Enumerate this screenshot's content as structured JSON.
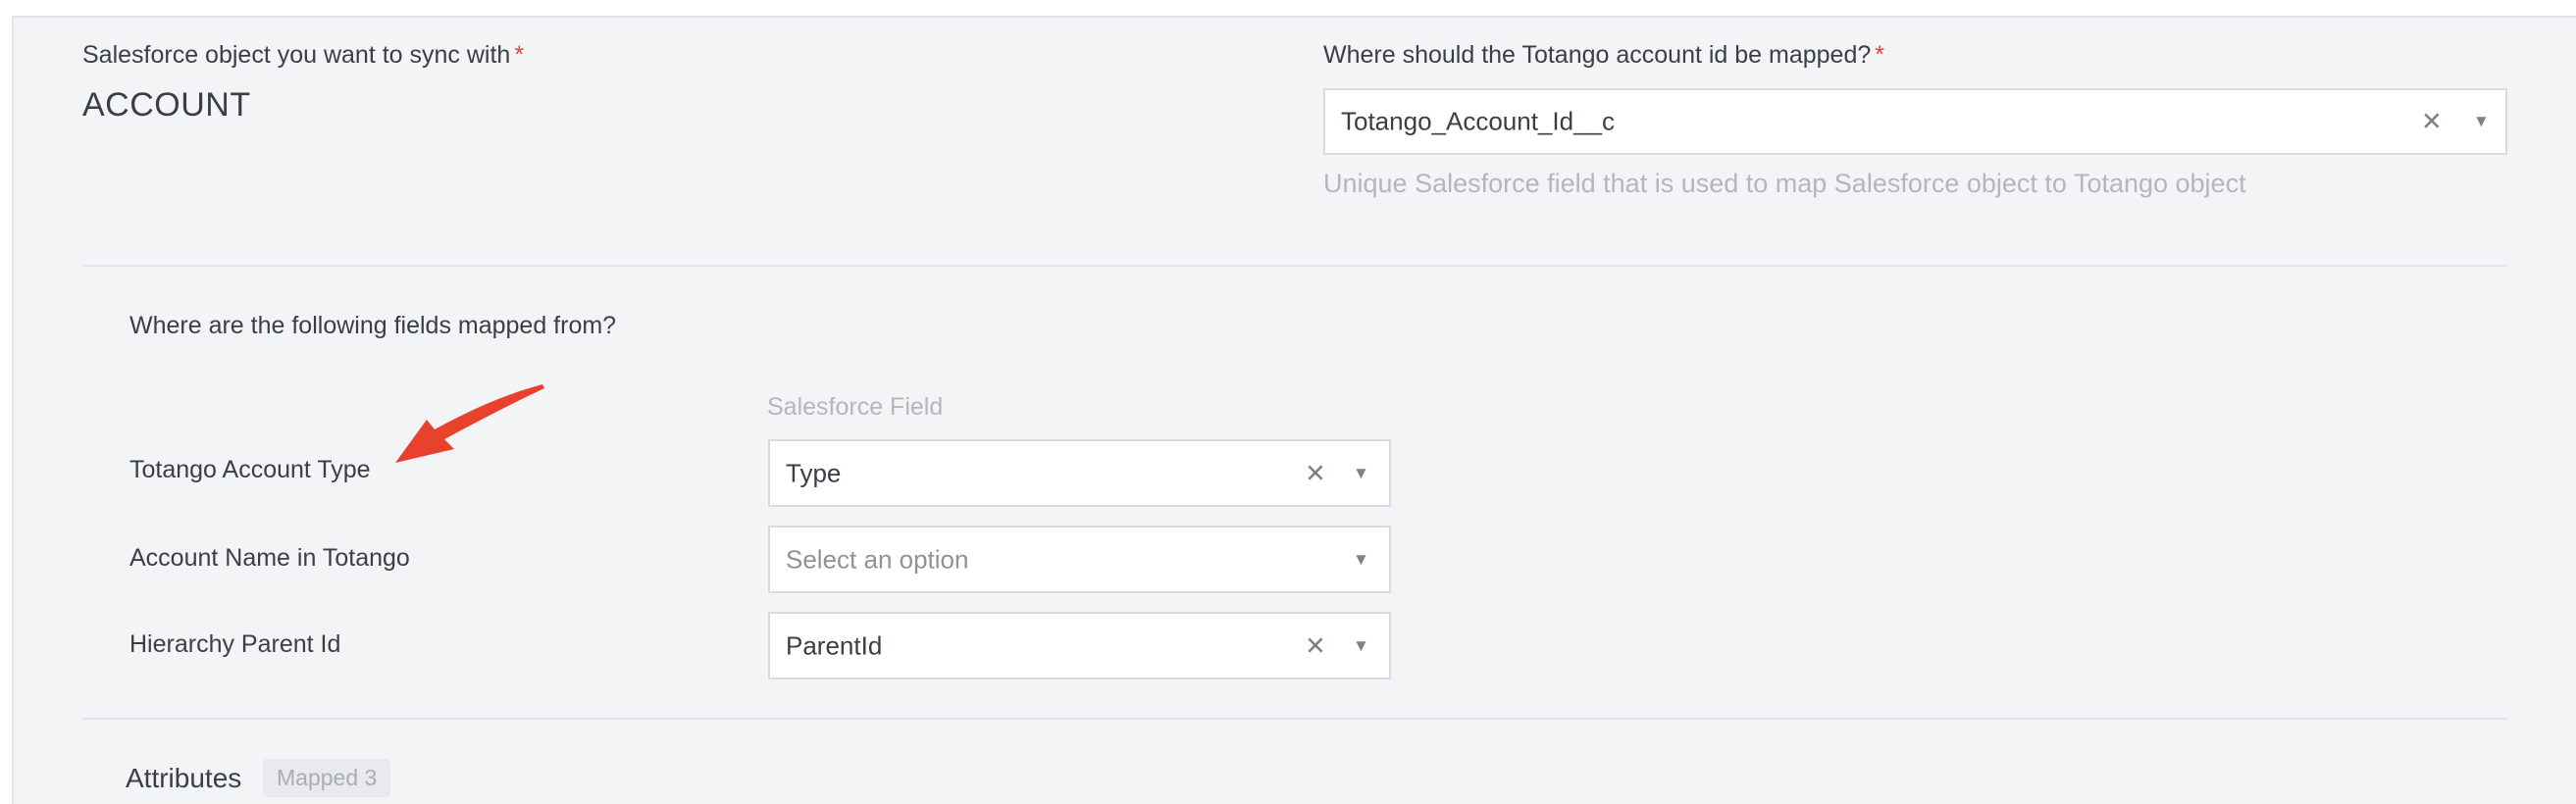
{
  "sync": {
    "object_label": "Salesforce object you want to sync with",
    "required_mark": "*",
    "object_value": "ACCOUNT"
  },
  "mapping": {
    "id_label": "Where should the Totango account id be mapped?",
    "required_mark": "*",
    "id_value": "Totango_Account_Id__c",
    "id_hint": "Unique Salesforce field that is used to map Salesforce object to Totango object"
  },
  "fields": {
    "heading": "Where are the following fields mapped from?",
    "column_header": "Salesforce Field",
    "rows": [
      {
        "label": "Totango Account Type",
        "value": "Type",
        "placeholder": ""
      },
      {
        "label": "Account Name in Totango",
        "value": "",
        "placeholder": "Select an option"
      },
      {
        "label": "Hierarchy Parent Id",
        "value": "ParentId",
        "placeholder": ""
      }
    ]
  },
  "attributes": {
    "title": "Attributes",
    "badge": "Mapped 3"
  },
  "icons": {
    "clear": "clear-x-icon",
    "caret": "caret-down-icon",
    "annotation": "red-arrow-annotation"
  },
  "colors": {
    "background": "#f3f4f6",
    "required": "#e0453a",
    "annotation_arrow": "#e8412c"
  }
}
